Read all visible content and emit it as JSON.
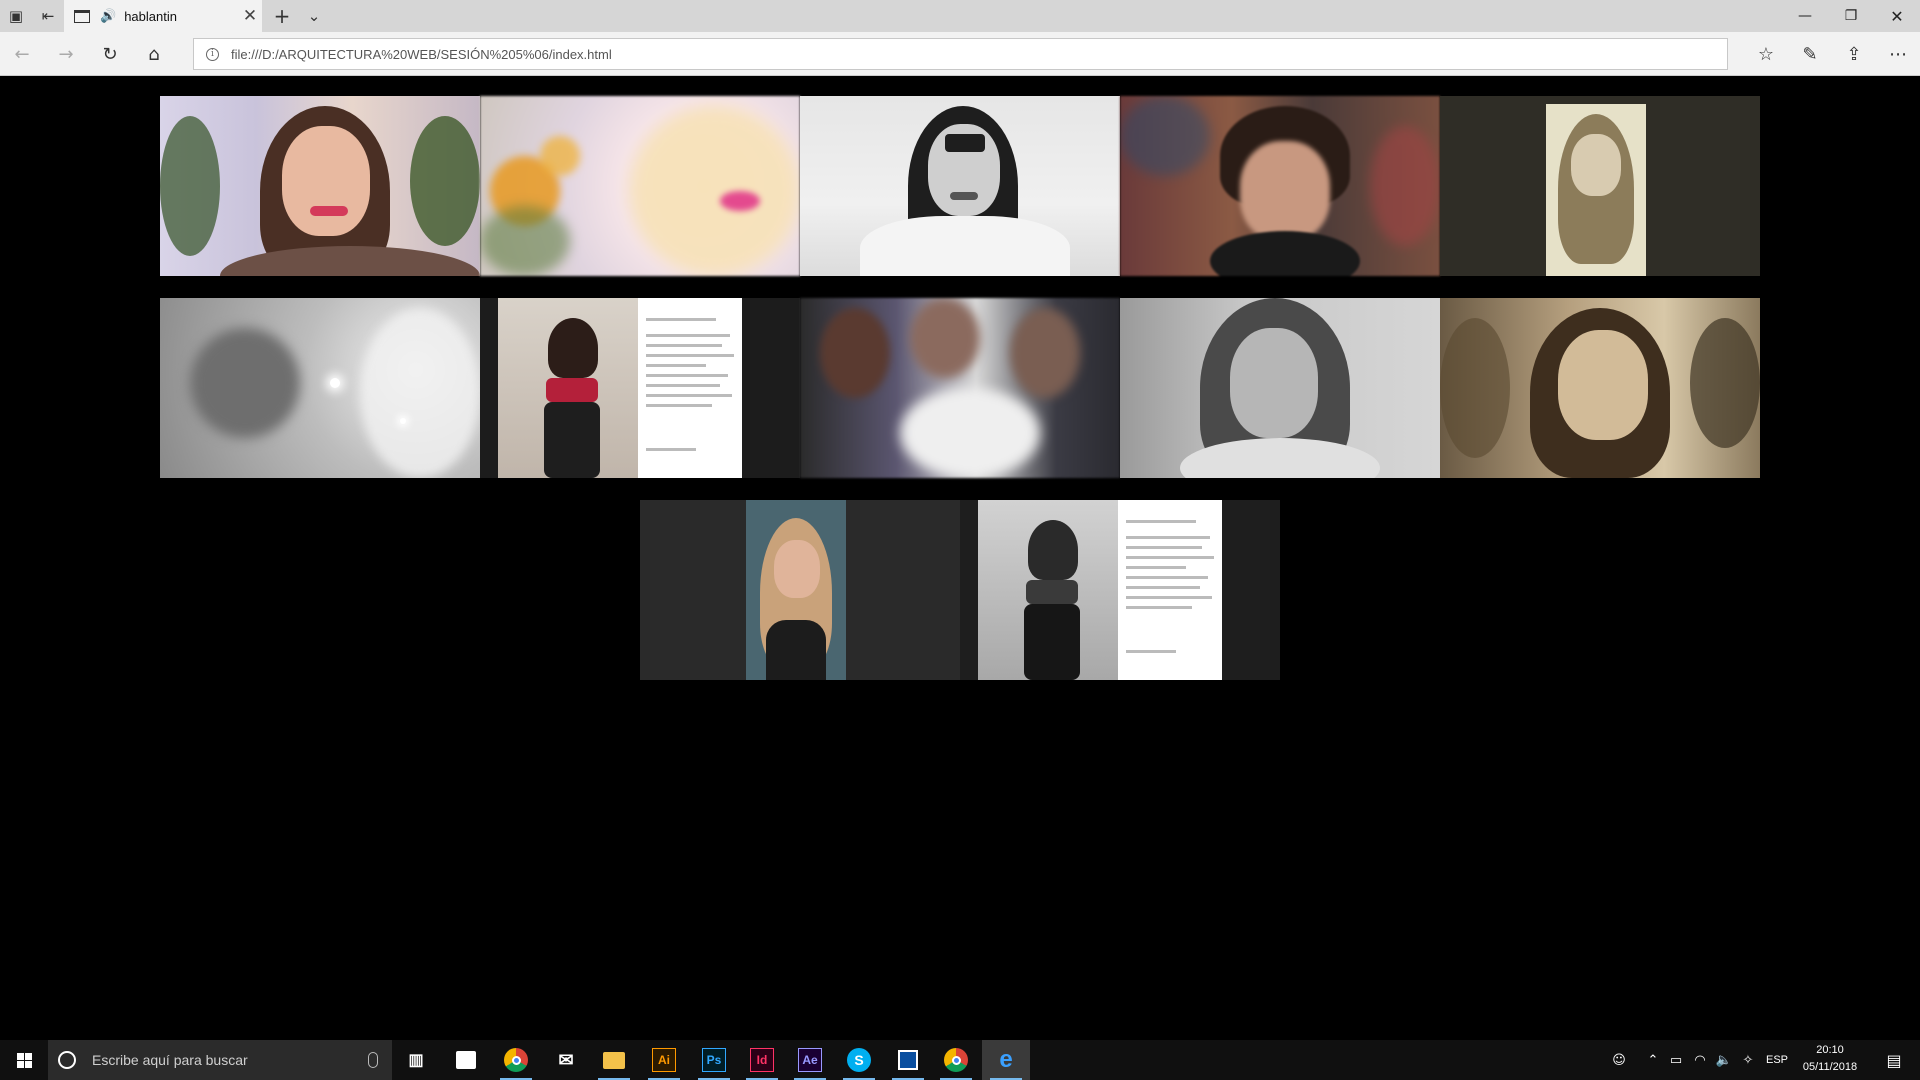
{
  "browser": {
    "tab": {
      "title": "hablantin"
    },
    "address": {
      "url": "file:///D:/ARQUITECTURA%20WEB/SESIÓN%205%06/index.html"
    }
  },
  "gallery": {
    "rows": [
      {
        "items": [
          {
            "id": "t1",
            "tone": "color",
            "subject": "woman smiling, plant background"
          },
          {
            "id": "t2",
            "tone": "color-blurred",
            "subject": "sunflowers and blonde hair"
          },
          {
            "id": "t3",
            "tone": "grayscale",
            "subject": "woman with bangs on white bed"
          },
          {
            "id": "t4",
            "tone": "color-blurred",
            "subject": "young man with headphones"
          },
          {
            "id": "t5",
            "tone": "sepia",
            "subject": "instagram story screenshot"
          }
        ]
      },
      {
        "items": [
          {
            "id": "t6",
            "tone": "grayscale",
            "subject": "flowers and smiling girl"
          },
          {
            "id": "t7",
            "tone": "color",
            "subject": "instagram post screenshot"
          },
          {
            "id": "t8",
            "tone": "color-blurred",
            "subject": "group photo"
          },
          {
            "id": "t9",
            "tone": "grayscale",
            "subject": "woman looking down"
          },
          {
            "id": "t10",
            "tone": "sepia",
            "subject": "woman smiling, plant background"
          }
        ]
      },
      {
        "items": [
          {
            "id": "t11",
            "tone": "color",
            "subject": "instagram story, girl in car"
          },
          {
            "id": "t12",
            "tone": "grayscale",
            "subject": "instagram post screenshot"
          }
        ]
      }
    ]
  },
  "taskbar": {
    "search_placeholder": "Escribe aquí para buscar",
    "apps": [
      {
        "name": "task-view",
        "label": ""
      },
      {
        "name": "store",
        "label": ""
      },
      {
        "name": "chrome",
        "label": ""
      },
      {
        "name": "mail",
        "label": ""
      },
      {
        "name": "file-explorer",
        "label": ""
      },
      {
        "name": "illustrator",
        "label": "Ai"
      },
      {
        "name": "photoshop",
        "label": "Ps"
      },
      {
        "name": "indesign",
        "label": "Id"
      },
      {
        "name": "after-effects",
        "label": "Ae"
      },
      {
        "name": "skype",
        "label": "S"
      },
      {
        "name": "app-blue",
        "label": ""
      },
      {
        "name": "chrome-2",
        "label": ""
      },
      {
        "name": "edge",
        "label": "e"
      }
    ],
    "tray": {
      "language": "ESP"
    },
    "clock": {
      "time": "20:10",
      "date": "05/11/2018"
    }
  },
  "colors": {
    "taskbar": "#101010",
    "accent": "#76b9ed",
    "page_bg": "#000000"
  }
}
